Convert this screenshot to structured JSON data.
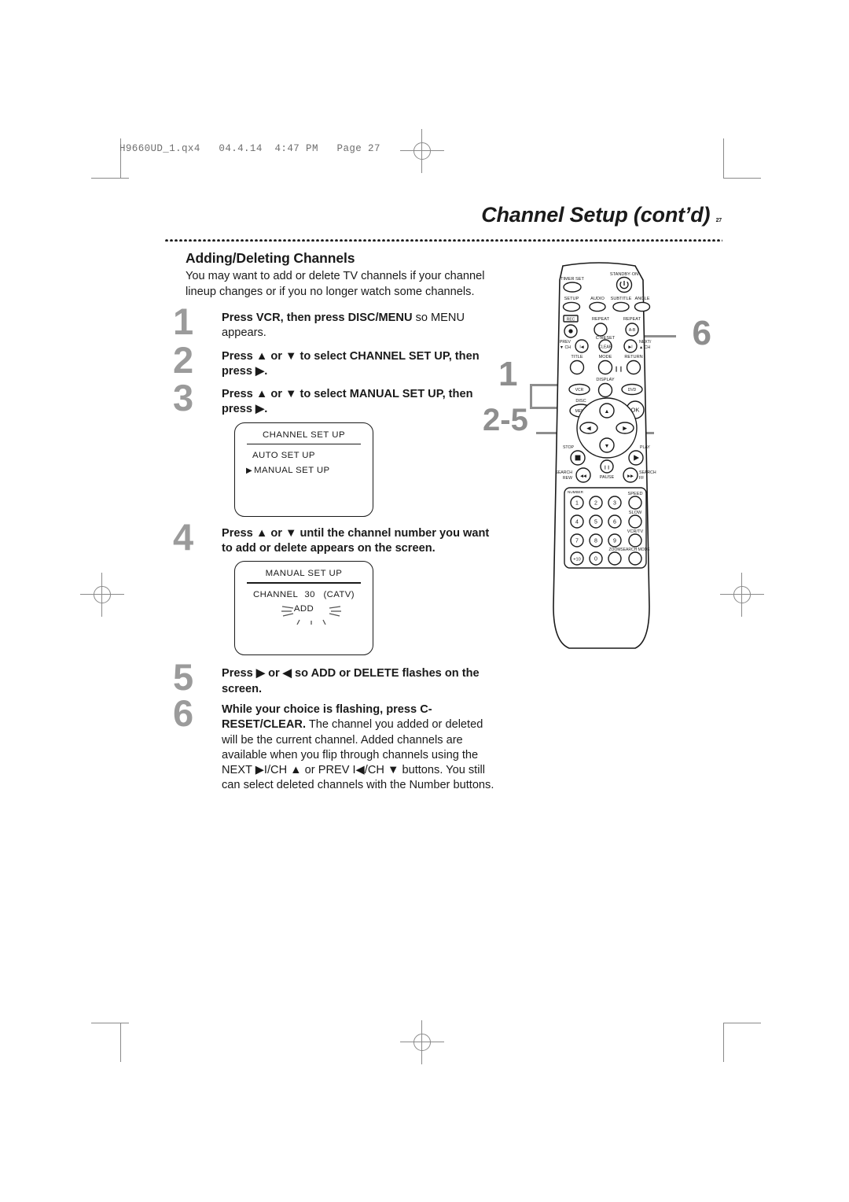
{
  "print_slug": "H9660UD_1.qx4   04.4.14  4:47 PM   Page 27",
  "page": {
    "title": "Channel Setup (cont’d)",
    "number": "27"
  },
  "section": {
    "heading": "Adding/Deleting Channels",
    "intro": "You may want to add or delete TV channels if your channel lineup changes or if you no longer watch some channels."
  },
  "steps": [
    {
      "number": "1",
      "html": "<b>Press VCR, then press DISC/MENU</b> <span class=\"nb\">so MENU appears.</span>"
    },
    {
      "number": "2",
      "html": "<b>Press ▲ or ▼ to select CHANNEL SET UP, then press ▶.</b>"
    },
    {
      "number": "3",
      "html": "<b>Press ▲ or ▼ to select MANUAL SET UP, then press ▶.</b>"
    },
    {
      "number": "4",
      "html": "<b>Press ▲ or ▼ until the channel number you want to add or delete appears on the screen.</b>"
    },
    {
      "number": "5",
      "html": "<b>Press ▶ or ◀ so ADD or DELETE flashes on the screen.</b>"
    },
    {
      "number": "6",
      "html": "<b>While your choice is flashing, press C-RESET/CLEAR.</b> <span class=\"nb\">The channel you added or deleted will be the current channel. Added channels are available when you flip through channels using the NEXT ▶I/CH ▲ or PREV I◀/CH ▼ buttons. You still can select deleted channels with the Number buttons.</span>"
    }
  ],
  "osd_channel_setup": {
    "title": "CHANNEL SET UP",
    "items": [
      "AUTO SET UP",
      "MANUAL SET UP"
    ],
    "cursor_glyph": "▶",
    "selected_index": 1
  },
  "osd_manual_setup": {
    "title": "MANUAL SET UP",
    "label": "CHANNEL",
    "channel": "30",
    "band": "(CATV)",
    "flashing_value": "ADD"
  },
  "remote": {
    "callouts": [
      {
        "label": "6",
        "target": "c-reset-clear-button"
      },
      {
        "label": "1",
        "target": "vcr-button"
      },
      {
        "label": "2-5",
        "target": "cursor-pad"
      }
    ],
    "buttons": {
      "timer_set": "TIMER SET",
      "standby_on": "STANDBY·ON",
      "setup": "SETUP",
      "audio": "AUDIO",
      "subtitle": "SUBTITLE",
      "angle": "ANGLE",
      "rec": "REC",
      "repeat": "REPEAT",
      "repeat_ab": "REPEAT",
      "repeat_ab_glyph": "A-B",
      "prev": "PREV",
      "prev_ch": "▼ CH",
      "c_reset": "C-RESET",
      "clear": "CLEAR",
      "next": "NEXT/",
      "next_ch": "▲ CH",
      "title": "TITLE",
      "mode": "MODE",
      "return": "RETURN",
      "display": "DISPLAY",
      "vcr": "VCR",
      "dvd": "DVD",
      "disc": "DISC",
      "menu": "MENU",
      "ok": "OK",
      "stop": "STOP",
      "play": "PLAY",
      "search_rew": "SEARCH\nREW",
      "pause": "PAUSE",
      "search_ff": "SEARCH\nFF",
      "number": "NUMBER",
      "speed": "SPEED",
      "slow": "SLOW",
      "vcr_tv": "VCR/TV",
      "zoom": "ZOOM",
      "search_mode": "SEARCH MODE",
      "numbers": [
        "1",
        "2",
        "3",
        "4",
        "5",
        "6",
        "7",
        "8",
        "9",
        "+10",
        "0"
      ]
    }
  },
  "colors": {
    "ink": "#1a1a1a",
    "callout_gray": "#8e8e8e",
    "stepnum_gray": "#9b9b9b",
    "slug_gray": "#6e6e6e",
    "mark_gray": "#8a8a8a"
  }
}
